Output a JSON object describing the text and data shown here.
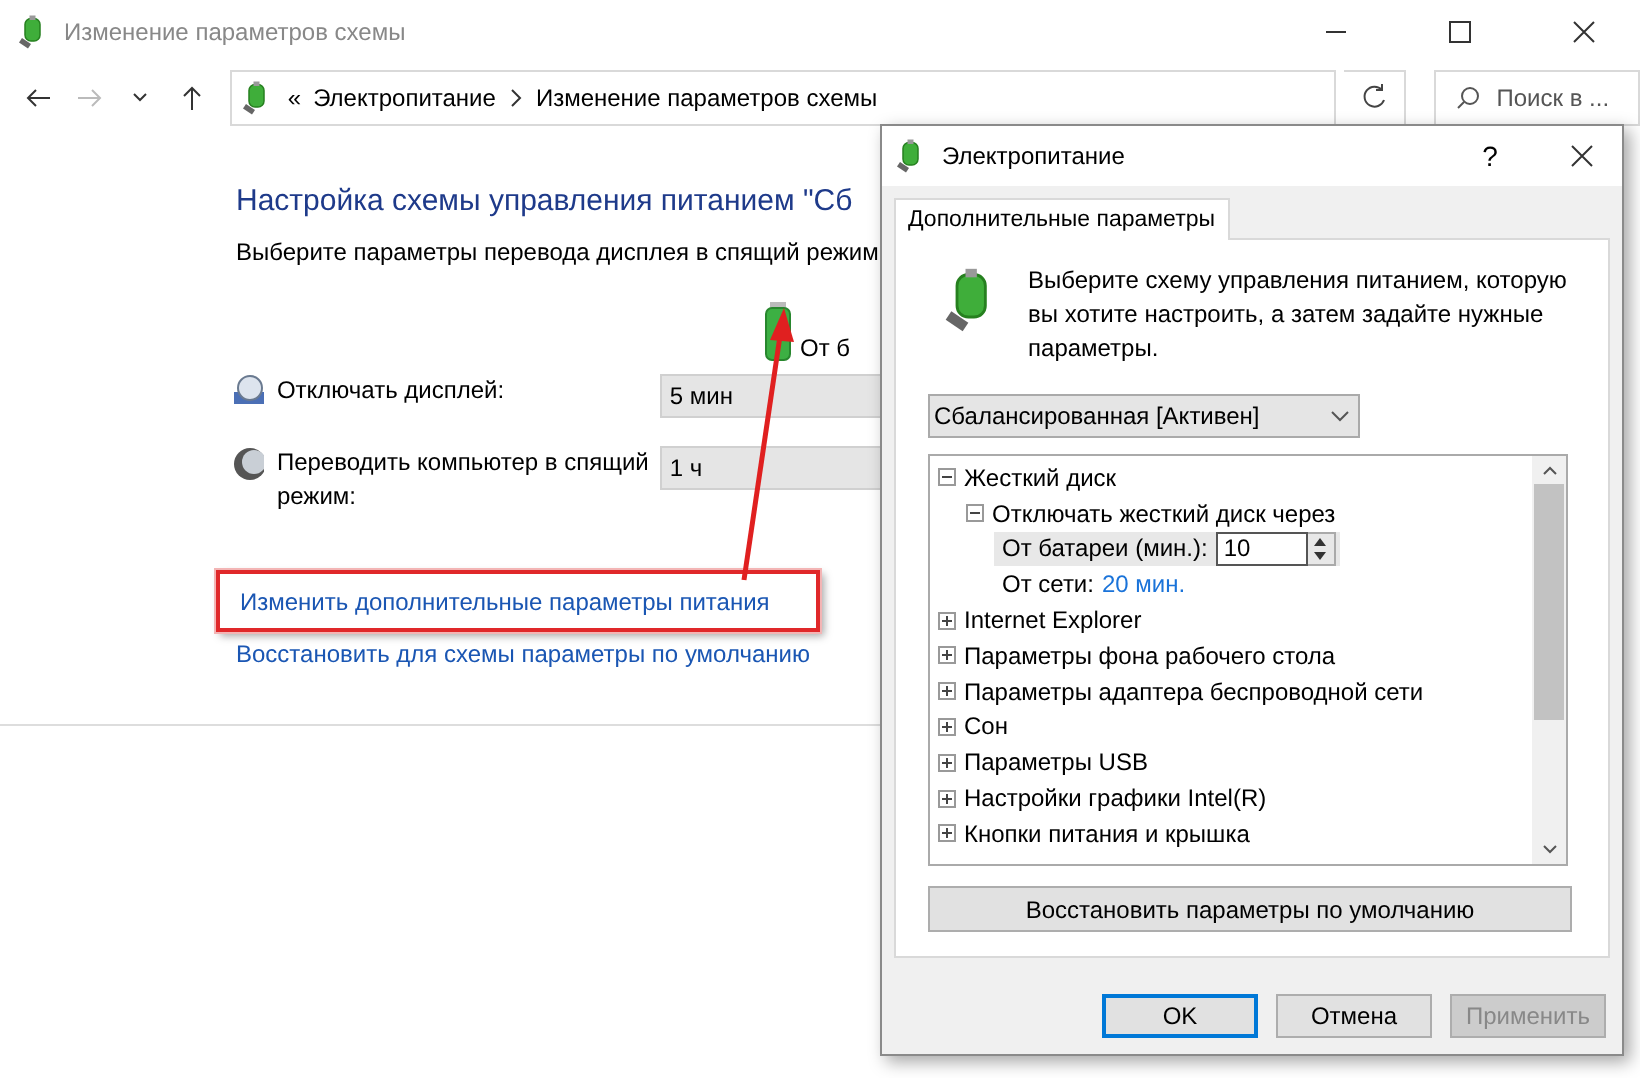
{
  "window": {
    "title": "Изменение параметров схемы"
  },
  "address_bar": {
    "overflow": "«",
    "path": [
      "Электропитание",
      "Изменение параметров схемы"
    ]
  },
  "search": {
    "placeholder": "Поиск в ..."
  },
  "main": {
    "heading": "Настройка схемы управления питанием \"Сб",
    "subtitle": "Выберите параметры перевода дисплея в спящий режим",
    "column_label": "От б",
    "settings": [
      {
        "kind": "display",
        "label": "Отключать дисплей:",
        "value": "5 мин"
      },
      {
        "kind": "sleep",
        "label": "Переводить компьютер в спящий режим:",
        "value": "1 ч"
      }
    ],
    "links": [
      {
        "label": "Изменить дополнительные параметры питания",
        "highlighted": true
      },
      {
        "label": "Восстановить для схемы параметры по умолчанию",
        "highlighted": false
      }
    ]
  },
  "dialog": {
    "title": "Электропитание",
    "help": "?",
    "tabs": [
      {
        "label": "Дополнительные параметры",
        "selected": true
      }
    ],
    "intro": "Выберите схему управления питанием, которую вы хотите настроить, а затем задайте нужные параметры.",
    "scheme": "Сбалансированная [Активен]",
    "tree": [
      {
        "label": "Жесткий диск",
        "expanded": true,
        "children": [
          {
            "label": "Отключать жесткий диск через",
            "expanded": true,
            "children": [
              {
                "kind": "spin",
                "label": "От батареи (мин.):",
                "value": "10",
                "selected": true
              },
              {
                "kind": "value",
                "label": "От сети:",
                "value": "20 мин.",
                "selected": false
              }
            ]
          }
        ]
      },
      {
        "label": "Internet Explorer",
        "expanded": false
      },
      {
        "label": "Параметры фона рабочего стола",
        "expanded": false
      },
      {
        "label": "Параметры адаптера беспроводной сети",
        "expanded": false
      },
      {
        "label": "Сон",
        "expanded": false
      },
      {
        "label": "Параметры USB",
        "expanded": false
      },
      {
        "label": "Настройки графики Intel(R)",
        "expanded": false
      },
      {
        "label": "Кнопки питания и крышка",
        "expanded": false
      }
    ],
    "restore_button": "Восстановить параметры по умолчанию",
    "buttons": [
      {
        "label": "OK",
        "disabled": false,
        "default": true
      },
      {
        "label": "Отмена",
        "disabled": false,
        "default": false
      },
      {
        "label": "Применить",
        "disabled": true,
        "default": false
      }
    ]
  }
}
